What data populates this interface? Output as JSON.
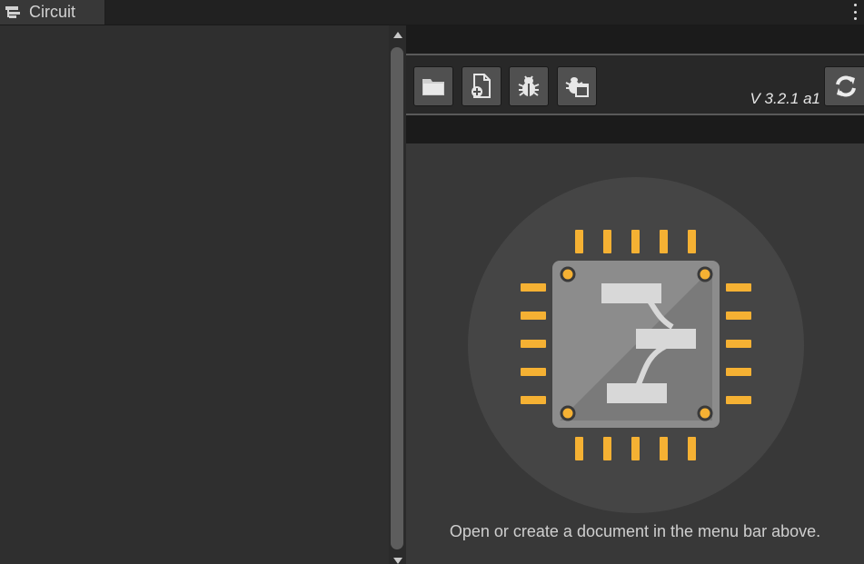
{
  "tab": {
    "title": "Circuit",
    "icon": "hierarchy-icon"
  },
  "menu": {
    "icon": "kebab-menu-icon"
  },
  "toolbar": {
    "buttons": [
      {
        "name": "open-folder",
        "icon": "folder-icon"
      },
      {
        "name": "new-document",
        "icon": "new-file-icon"
      },
      {
        "name": "debug",
        "icon": "bug-icon"
      },
      {
        "name": "debug-window",
        "icon": "bug-window-icon"
      }
    ],
    "refresh_icon": "refresh-icon",
    "version": "V 3.2.1 a1"
  },
  "main": {
    "logo": "circuit-chip-logo",
    "hint": "Open or create a document in the menu bar above."
  },
  "colors": {
    "accent": "#f5b133",
    "chip": "#8c8c8c",
    "background": "#383838"
  }
}
